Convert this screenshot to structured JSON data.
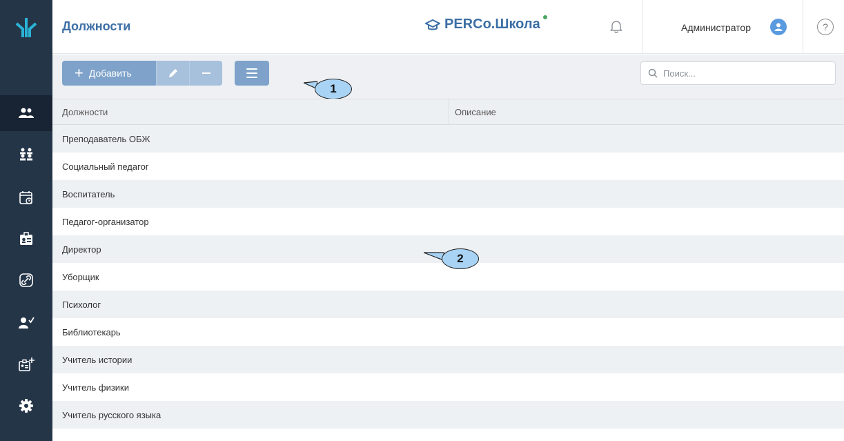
{
  "header": {
    "title": "Должности",
    "brand": "PERCo.Школа",
    "user_name": "Администратор",
    "help_label": "?"
  },
  "sidebar": {
    "items": [
      {
        "icon": "users-icon",
        "active": true
      },
      {
        "icon": "groups-icon",
        "active": false
      },
      {
        "icon": "calendar-clock-icon",
        "active": false
      },
      {
        "icon": "id-badge-icon",
        "active": false
      },
      {
        "icon": "link-icon",
        "active": false
      },
      {
        "icon": "user-check-icon",
        "active": false
      },
      {
        "icon": "badge-add-icon",
        "active": false
      },
      {
        "icon": "gear-icon",
        "active": false
      }
    ]
  },
  "toolbar": {
    "add_label": "Добавить",
    "search_placeholder": "Поиск..."
  },
  "callouts": {
    "one": "1",
    "two": "2"
  },
  "table": {
    "columns": [
      "Должности",
      "Описание"
    ],
    "rows": [
      [
        "Преподаватель ОБЖ",
        ""
      ],
      [
        "Социальный педагог",
        ""
      ],
      [
        "Воспитатель",
        ""
      ],
      [
        "Педагог-организатор",
        ""
      ],
      [
        "Директор",
        ""
      ],
      [
        "Уборщик",
        ""
      ],
      [
        "Психолог",
        ""
      ],
      [
        "Библиотекарь",
        ""
      ],
      [
        "Учитель истории",
        ""
      ],
      [
        "Учитель физики",
        ""
      ],
      [
        "Учитель русского языка",
        ""
      ]
    ]
  },
  "colors": {
    "sidebar": "#253548",
    "accent": "#3d6fa6",
    "button": "#7ea2c9",
    "status_dot": "#4aa564"
  }
}
